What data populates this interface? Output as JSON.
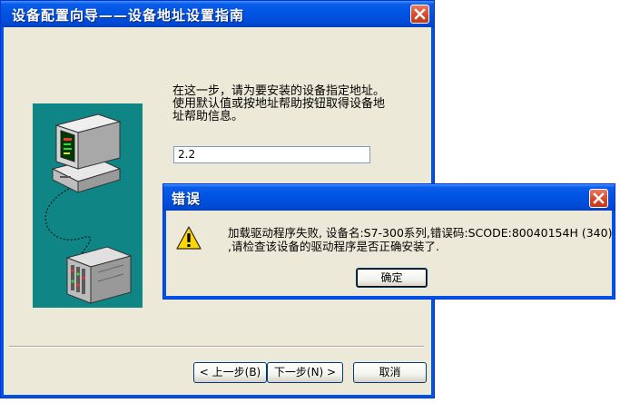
{
  "wizard": {
    "title": "设备配置向导——设备地址设置指南",
    "instruction_line1": "在这一步，请为要安装的设备指定地址。",
    "instruction_line2": "使用默认值或按地址帮助按钮取得设备地",
    "instruction_line3": "址帮助信息。",
    "address_value": "2.2",
    "back_button": "< 上一步(B)",
    "next_button": "下一步(N) >",
    "cancel_button": "取消"
  },
  "error_dialog": {
    "title": "错误",
    "message_line1": "加载驱动程序失败, 设备名:S7-300系列,错误码:SCODE:80040154H (340)",
    "message_line2": ",请检查该设备的驱动程序是否正确安装了.",
    "ok_button": "确定",
    "icon": "warning-icon"
  },
  "colors": {
    "titlebar": "#0054e3",
    "dialog_face": "#ece9d8",
    "illustration_bg": "#0f8585",
    "close_button": "#d7482a"
  }
}
